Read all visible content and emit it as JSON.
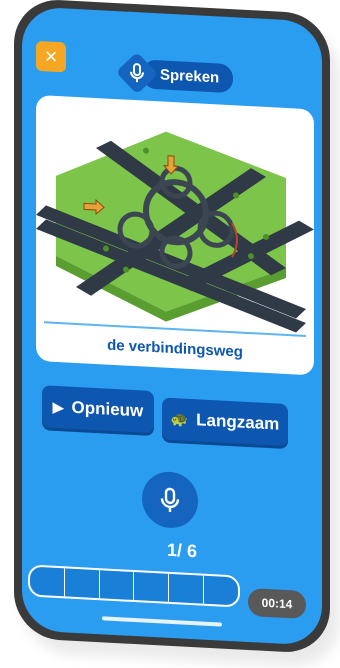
{
  "header": {
    "close_icon": "close-icon",
    "mode_label": "Spreken",
    "mode_icon": "microphone-icon"
  },
  "card": {
    "image_description_icon": "highway-interchange-illustration",
    "word": "de verbindingsweg"
  },
  "controls": {
    "replay_label": "Opnieuw",
    "replay_icon": "play-icon",
    "slow_label": "Langzaam",
    "slow_icon": "turtle-icon",
    "record_icon": "microphone-icon"
  },
  "progress": {
    "current": "1",
    "total": "6",
    "segments": 6,
    "filled": 0
  },
  "timer": "00:14",
  "colors": {
    "background": "#2a9df0",
    "button": "#0d57b0",
    "close": "#f5a623",
    "timer_bg": "#595959"
  }
}
